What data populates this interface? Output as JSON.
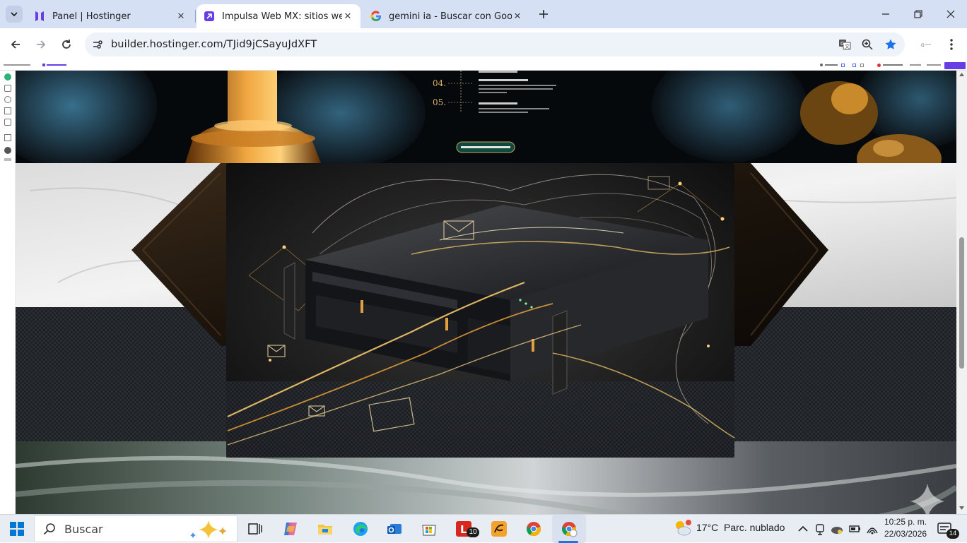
{
  "browser": {
    "tabs": [
      {
        "title": "Panel | Hostinger"
      },
      {
        "title": "Impulsa Web MX: sitios web qu"
      },
      {
        "title": "gemini ia - Buscar con Google"
      }
    ],
    "url": "builder.hostinger.com/TJid9jCSayuJdXFT"
  },
  "page": {
    "step_04": "04.",
    "step_05": "05."
  },
  "taskbar": {
    "search_placeholder": "Buscar",
    "badge_count": "10",
    "weather_temp": "17°C",
    "weather_desc": "Parc. nublado",
    "time": "10:25 p. m.",
    "date": "22/03/2026",
    "notif_count": "14"
  }
}
